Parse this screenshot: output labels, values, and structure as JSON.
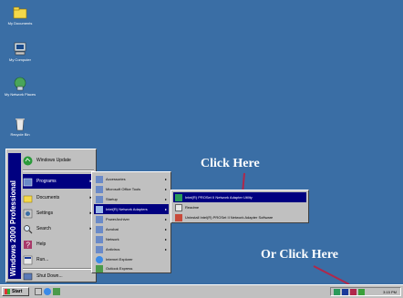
{
  "desktop": {
    "background": "#3a6ea5",
    "icons": [
      {
        "label": "My Documents",
        "icon": "folder-icon",
        "color": "#f5d94a"
      },
      {
        "label": "My Computer",
        "icon": "computer-icon",
        "color": "#c8d6e0"
      },
      {
        "label": "My Network Places",
        "icon": "network-icon",
        "color": "#4aa55a"
      },
      {
        "label": "Recycle Bin",
        "icon": "recycle-bin-icon",
        "color": "#e8e8e8"
      }
    ]
  },
  "callouts": {
    "click_here": "Click Here",
    "or_click_here": "Or Click Here",
    "arrow_color": "#b0284a"
  },
  "start_menu": {
    "banner": "Windows 2000 Professional",
    "items": [
      {
        "label": "Windows Update",
        "icon": "windows-update-icon"
      },
      {
        "label": "Programs",
        "icon": "programs-icon",
        "arrow": "▸"
      },
      {
        "label": "Documents",
        "icon": "documents-icon",
        "arrow": "▸"
      },
      {
        "label": "Settings",
        "icon": "settings-icon",
        "arrow": "▸"
      },
      {
        "label": "Search",
        "icon": "search-icon",
        "arrow": "▸"
      },
      {
        "label": "Help",
        "icon": "help-icon"
      },
      {
        "label": "Run...",
        "icon": "run-icon"
      },
      {
        "label": "Shut Down...",
        "icon": "shutdown-icon"
      }
    ]
  },
  "programs_menu": {
    "items": [
      {
        "label": "Accessories",
        "arrow": "▸"
      },
      {
        "label": "Microsoft Office Tools",
        "arrow": "▸"
      },
      {
        "label": "Startup",
        "arrow": "▸"
      },
      {
        "label": "Intel(R) Network Adapters",
        "arrow": "▸"
      },
      {
        "label": "PowerArchiver",
        "arrow": "▸"
      },
      {
        "label": "Acrobat",
        "arrow": "▸"
      },
      {
        "label": "Network",
        "arrow": "▸"
      },
      {
        "label": "Antivirus",
        "arrow": "▸"
      },
      {
        "label": "Internet Explorer",
        "arrow": ""
      },
      {
        "label": "Outlook Express",
        "arrow": ""
      }
    ]
  },
  "network_submenu": {
    "items": [
      {
        "label": "Intel(R) PROSet II Network Adapter Utility"
      },
      {
        "label": "Readme"
      },
      {
        "label": "Uninstall Intel(R) PROSet II Network Adapter Software"
      }
    ]
  },
  "taskbar": {
    "start_label": "Start",
    "clock": "3:15 PM"
  }
}
